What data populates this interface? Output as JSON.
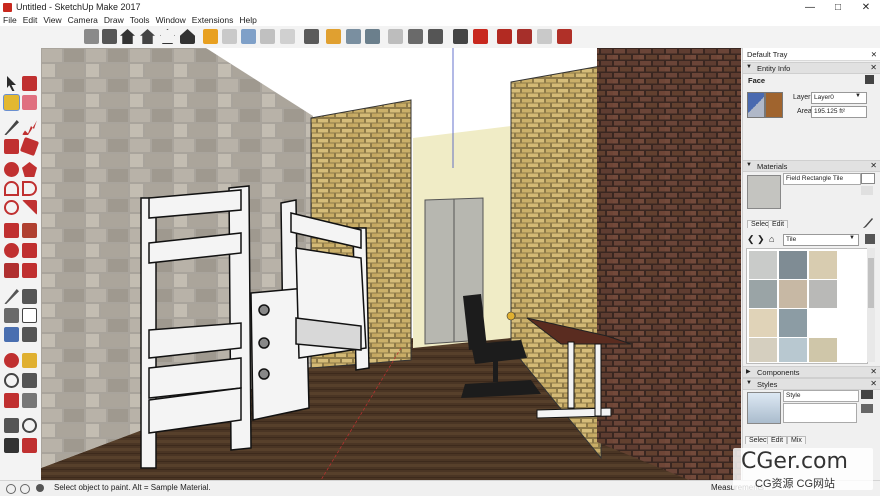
{
  "window": {
    "title": "Untitled - SketchUp Make 2017",
    "minimize": "—",
    "maximize": "□",
    "close": "✕"
  },
  "menu": [
    "File",
    "Edit",
    "View",
    "Camera",
    "Draw",
    "Tools",
    "Window",
    "Extensions",
    "Help"
  ],
  "toolbar_icons": [
    "orbit-icon",
    "pan-icon",
    "home-icon",
    "front-house-icon",
    "house-outline-icon",
    "house-side-icon",
    "get-models-icon",
    "share-model-icon",
    "search-3d-icon",
    "layout-icon",
    "upload-icon",
    "extension-icon",
    "component-icon",
    "shadow-icon",
    "fog-icon",
    "sound-icon",
    "sliders-icon",
    "camera-icon",
    "photo-icon",
    "ruby-icon",
    "warehouse-icon",
    "extension-manager-icon",
    "sandbox-icon"
  ],
  "tray": {
    "title": "Default Tray",
    "close": "✕",
    "entity_info": {
      "header": "Entity Info",
      "entity_type": "Face",
      "layer_label": "Layer:",
      "layer_value": "Layer0",
      "area_label": "Area:",
      "area_value": "195.125 ft²"
    },
    "materials": {
      "header": "Materials",
      "material_name": "Field Rectangle Tile",
      "tab_select": "Select",
      "tab_edit": "Edit",
      "library_value": "Tile",
      "swatches": [
        "#c9cbc9",
        "#7f8c94",
        "#d8ccb0",
        "#9aa4a6",
        "#c7b8a4",
        "#b9b9b7",
        "#e0d3b8",
        "#8c9ca4",
        "#ffffff",
        "#d5cfbf",
        "#b8c8d0",
        "#cfc6a9"
      ]
    },
    "components": {
      "header": "Components"
    },
    "styles": {
      "header": "Styles",
      "style_name": "Style",
      "tab_select": "Select",
      "tab_edit": "Edit",
      "tab_mix": "Mix"
    }
  },
  "status": {
    "message": "Select object to paint. Alt = Sample Material.",
    "measurements_label": "Measurements"
  },
  "watermark": {
    "line1": "CGer.com",
    "line2": "CG资源 CG网站"
  }
}
